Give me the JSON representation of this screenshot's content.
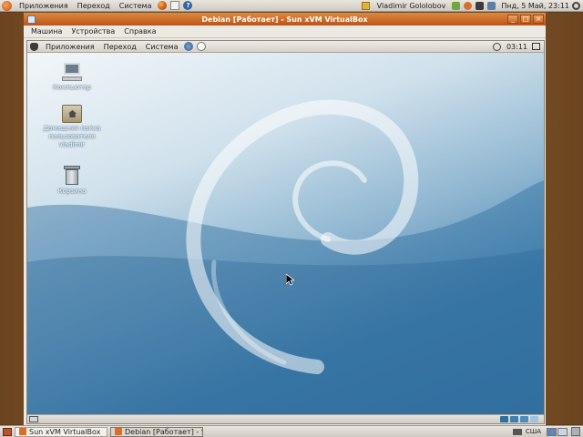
{
  "host_top_panel": {
    "menus": [
      "Приложения",
      "Переход",
      "Система"
    ],
    "user": "Vladimir Gololobov",
    "clock": "Пнд, 5 Май, 23:11"
  },
  "vbox_window": {
    "title": "Debian [Работает] - Sun xVM VirtualBox",
    "menus": [
      "Машина",
      "Устройства",
      "Справка"
    ],
    "window_buttons": [
      "_",
      "□",
      "×"
    ]
  },
  "guest": {
    "top_panel": {
      "menus": [
        "Приложения",
        "Переход",
        "Система"
      ],
      "clock": "03:11"
    },
    "desktop_icons": [
      {
        "name": "computer",
        "label": "Компьютер"
      },
      {
        "name": "home",
        "label_lines": [
          "Домашняя папка",
          "пользователя",
          "vladimir"
        ]
      },
      {
        "name": "trash",
        "label": "Корзина"
      }
    ]
  },
  "host_bottom_panel": {
    "tasks": [
      {
        "label": "Sun xVM VirtualBox",
        "active": false
      },
      {
        "label": "Debian [Работает] - S...",
        "active": true
      }
    ],
    "keyboard_layout": "США"
  },
  "colors": {
    "host_titlebar": "#c96a2a",
    "desktop_blue": "#3a77a6"
  }
}
